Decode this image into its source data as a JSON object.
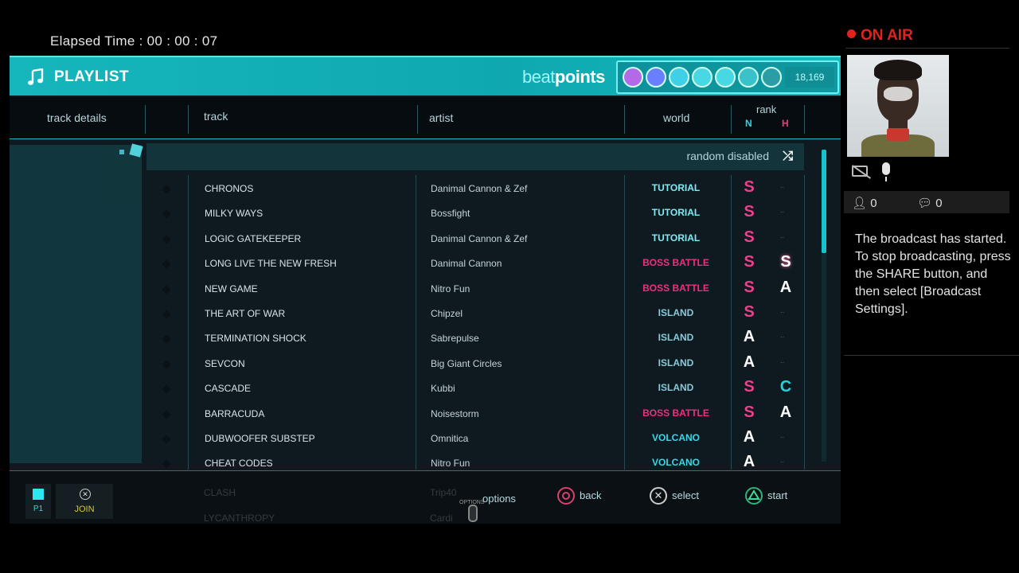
{
  "elapsed": "Elapsed Time : 00 : 00 : 07",
  "header": {
    "title": "PLAYLIST",
    "beat_prefix": "beat",
    "beat_suffix": "points",
    "beatpoints": "18,169",
    "badge_colors": [
      "#b46ae8",
      "#6a7fff",
      "#3fd0e8",
      "#48d8e4",
      "#48d8e4",
      "#39c2c9",
      "#2a9ea4"
    ]
  },
  "columns": {
    "track_details": "track details",
    "track": "track",
    "artist": "artist",
    "world": "world",
    "rank": "rank",
    "rank_n": "N",
    "rank_h": "H"
  },
  "random": "random disabled",
  "colors": {
    "tutorial": "#7feaf2",
    "boss": "#ee2f7e",
    "island": "#8ac9d9",
    "volcano": "#38d8e6",
    "rank_s": "#ee3f8a",
    "rank_a": "#ffffff",
    "rank_c": "#22d3db"
  },
  "rows": [
    {
      "track": "CHRONOS",
      "artist": "Danimal Cannon & Zef",
      "world": "TUTORIAL",
      "wtype": "tutorial",
      "n": "S",
      "ntype": "s",
      "h": "",
      "htype": ""
    },
    {
      "track": "MILKY WAYS",
      "artist": "Bossfight",
      "world": "TUTORIAL",
      "wtype": "tutorial",
      "n": "S",
      "ntype": "s",
      "h": "",
      "htype": ""
    },
    {
      "track": "LOGIC GATEKEEPER",
      "artist": "Danimal Cannon & Zef",
      "world": "TUTORIAL",
      "wtype": "tutorial",
      "n": "S",
      "ntype": "s",
      "h": "",
      "htype": ""
    },
    {
      "track": "LONG LIVE THE NEW FRESH",
      "artist": "Danimal Cannon",
      "world": "BOSS BATTLE",
      "wtype": "boss",
      "n": "S",
      "ntype": "s",
      "h": "S",
      "htype": "a"
    },
    {
      "track": "NEW GAME",
      "artist": "Nitro Fun",
      "world": "BOSS BATTLE",
      "wtype": "boss",
      "n": "S",
      "ntype": "s",
      "h": "A",
      "htype": "a"
    },
    {
      "track": "THE ART OF WAR",
      "artist": "Chipzel",
      "world": "ISLAND",
      "wtype": "island",
      "n": "S",
      "ntype": "s",
      "h": "",
      "htype": ""
    },
    {
      "track": "TERMINATION SHOCK",
      "artist": "Sabrepulse",
      "world": "ISLAND",
      "wtype": "island",
      "n": "A",
      "ntype": "a",
      "h": "",
      "htype": ""
    },
    {
      "track": "SEVCON",
      "artist": "Big Giant Circles",
      "world": "ISLAND",
      "wtype": "island",
      "n": "A",
      "ntype": "a",
      "h": "",
      "htype": ""
    },
    {
      "track": "CASCADE",
      "artist": "Kubbi",
      "world": "ISLAND",
      "wtype": "island",
      "n": "S",
      "ntype": "s",
      "h": "C",
      "htype": "c"
    },
    {
      "track": "BARRACUDA",
      "artist": "Noisestorm",
      "world": "BOSS BATTLE",
      "wtype": "boss",
      "n": "S",
      "ntype": "s",
      "h": "A",
      "htype": "a"
    },
    {
      "track": "DUBWOOFER SUBSTEP",
      "artist": "Omnitica",
      "world": "VOLCANO",
      "wtype": "volcano",
      "n": "A",
      "ntype": "a",
      "h": "",
      "htype": ""
    },
    {
      "track": "CHEAT CODES",
      "artist": "Nitro Fun",
      "world": "VOLCANO",
      "wtype": "volcano",
      "n": "A",
      "ntype": "a",
      "h": "",
      "htype": ""
    }
  ],
  "footer": {
    "p1": "P1",
    "join": "JOIN",
    "ghost_tracks": [
      "CLASH",
      "LYCANTHROPY"
    ],
    "ghost_artists": [
      "Trip40",
      "Cardi"
    ],
    "options_small": "OPTIONS",
    "options": "options",
    "back": "back",
    "select": "select",
    "start": "start"
  },
  "broadcast": {
    "onair": "ON AIR",
    "viewers": "0",
    "comments": "0",
    "message": "The broadcast has started.\nTo stop broadcasting, press the SHARE button, and then select [Broadcast Settings]."
  }
}
